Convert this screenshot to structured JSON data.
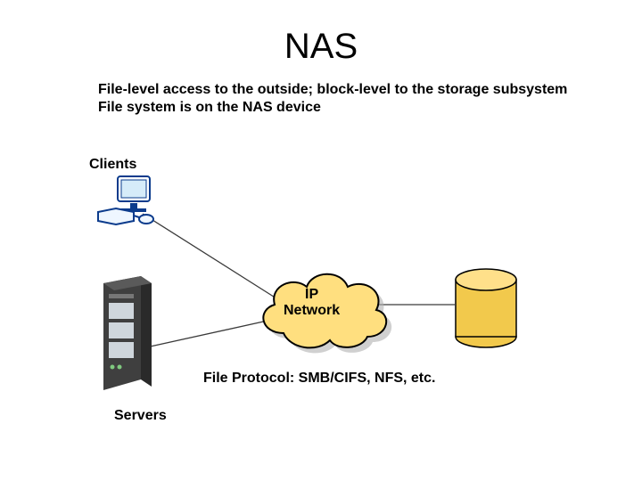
{
  "title": "NAS",
  "desc_line1": "File-level access to the outside; block-level to the storage subsystem",
  "desc_line2": "File system is on the NAS device",
  "labels": {
    "clients": "Clients",
    "servers": "Servers",
    "cloud_l1": "IP",
    "cloud_l2": "Network",
    "protocol": "File Protocol: SMB/CIFS, NFS, etc."
  },
  "icons": {
    "client": "client-pc-icon",
    "server": "server-icon",
    "cloud": "ip-network-cloud-icon",
    "storage": "storage-cylinder-icon"
  }
}
